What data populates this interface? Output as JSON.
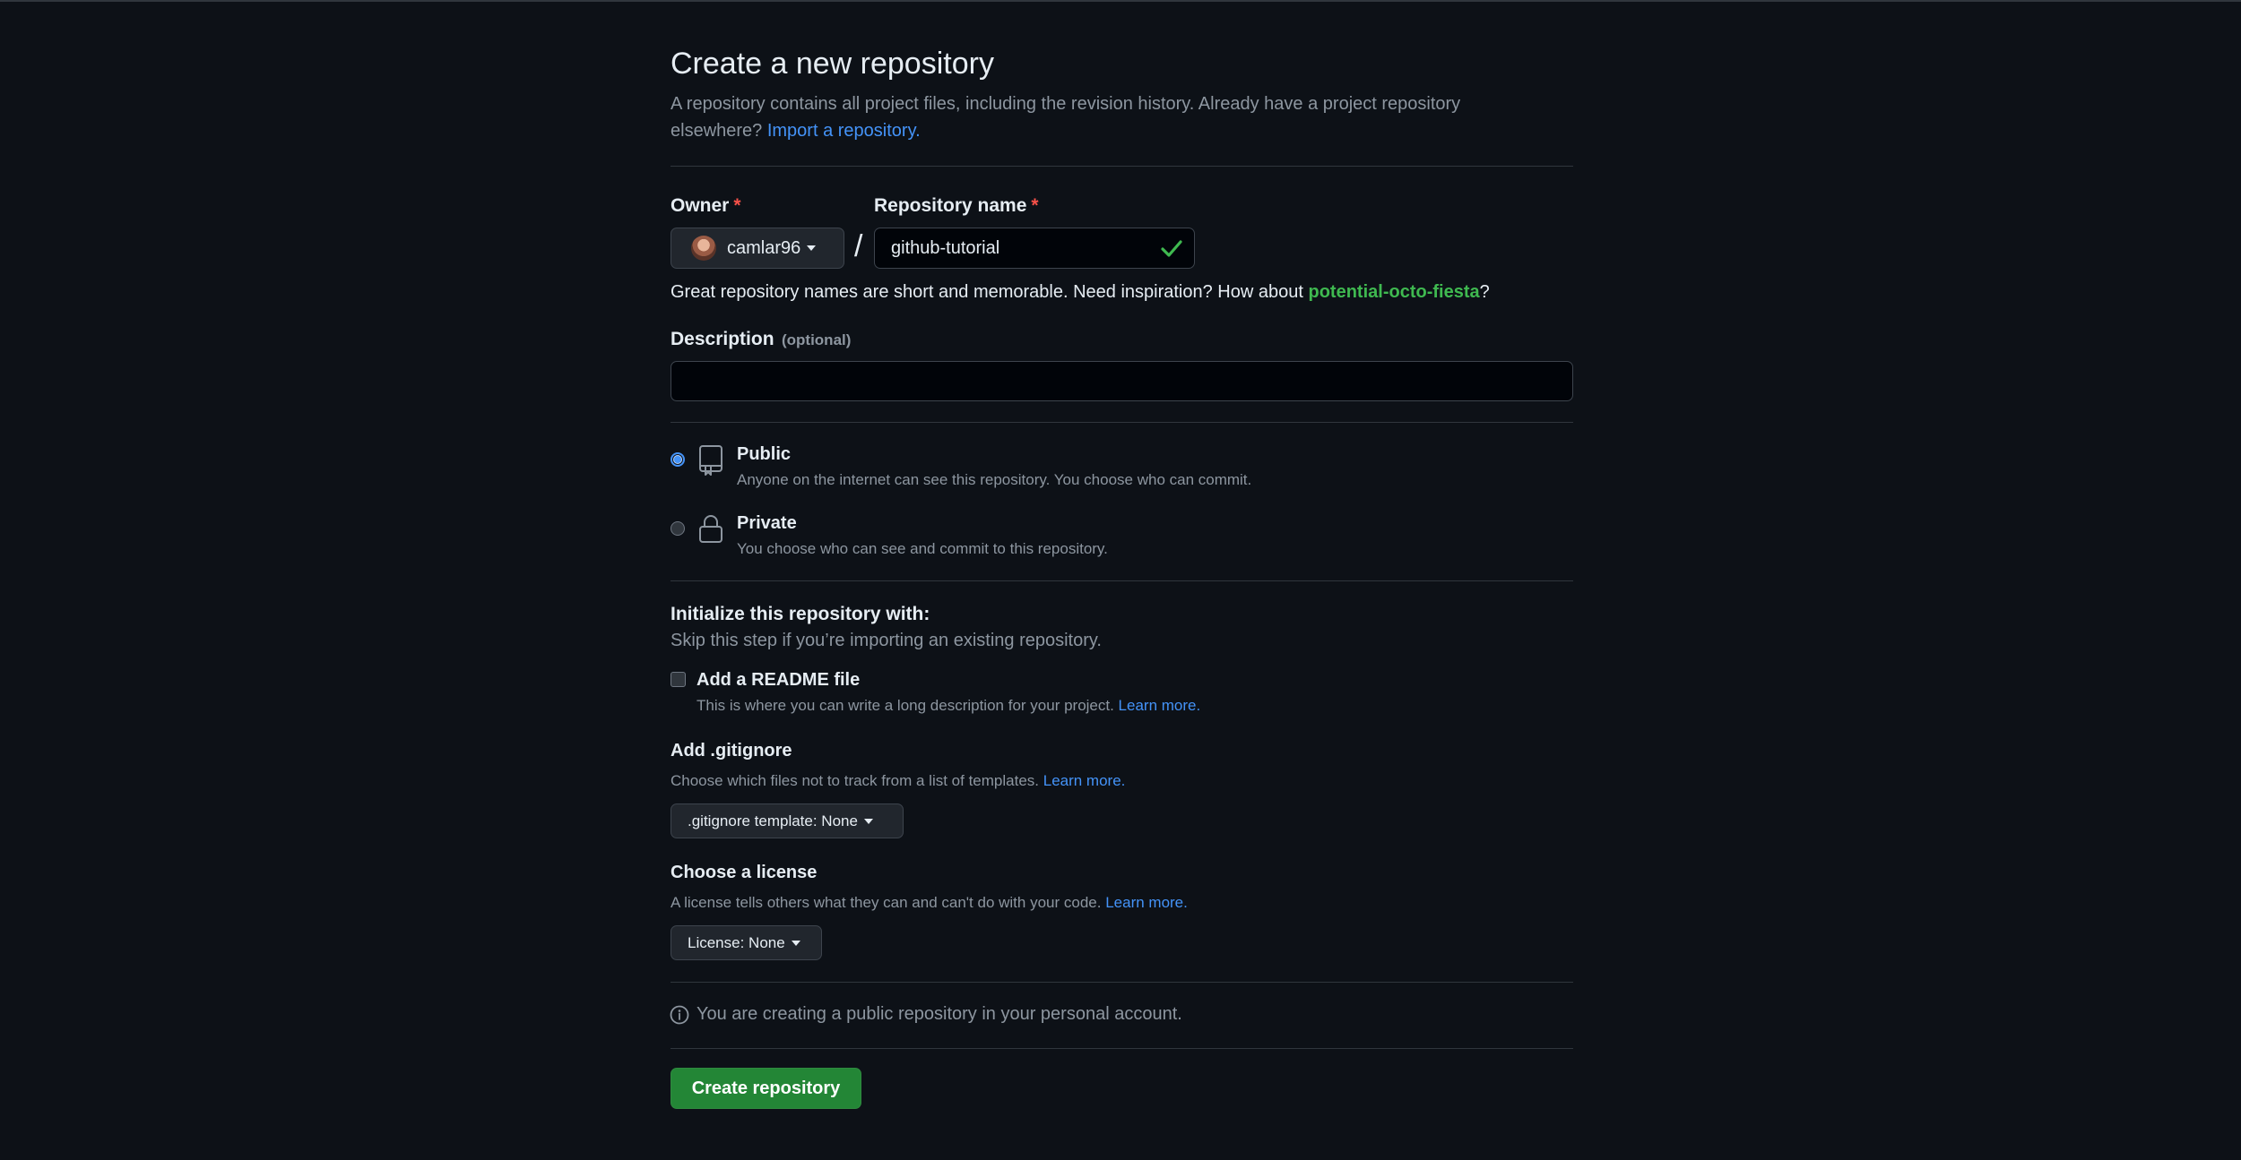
{
  "header": {
    "title": "Create a new repository",
    "intro_line1": "A repository contains all project files, including the revision history. Already have a project repository",
    "intro_line2_prefix": "elsewhere? ",
    "import_link": "Import a repository."
  },
  "owner": {
    "label": "Owner",
    "required_mark": "*",
    "value": "camlar96"
  },
  "slash": "/",
  "repo_name": {
    "label": "Repository name",
    "required_mark": "*",
    "value": "github-tutorial",
    "valid": true
  },
  "name_hint": {
    "prefix": "Great repository names are short and memorable. Need inspiration? How about ",
    "suggestion": "potential-octo-fiesta",
    "suffix": "?"
  },
  "description": {
    "label": "Description",
    "optional": "(optional)",
    "value": "",
    "placeholder": ""
  },
  "visibility": {
    "selected": "public",
    "public": {
      "title": "Public",
      "desc": "Anyone on the internet can see this repository. You choose who can commit.",
      "icon": "repo-icon"
    },
    "private": {
      "title": "Private",
      "desc": "You choose who can see and commit to this repository.",
      "icon": "lock-icon"
    }
  },
  "initialize": {
    "title": "Initialize this repository with:",
    "subtitle": "Skip this step if you’re importing an existing repository."
  },
  "readme": {
    "label": "Add a README file",
    "checked": false,
    "desc": "This is where you can write a long description for your project. ",
    "learn_more": "Learn more."
  },
  "gitignore": {
    "title": "Add .gitignore",
    "desc": "Choose which files not to track from a list of templates. ",
    "learn_more": "Learn more.",
    "button": ".gitignore template: None"
  },
  "license": {
    "title": "Choose a license",
    "desc": "A license tells others what they can and can't do with your code. ",
    "learn_more": "Learn more.",
    "button": "License: None"
  },
  "notice": {
    "icon": "info-icon",
    "text": "You are creating a public repository in your personal account."
  },
  "submit": {
    "label": "Create repository"
  },
  "colors": {
    "background": "#0d1117",
    "accent_link": "#4493f8",
    "success_green": "#3fb950",
    "primary_button": "#238636",
    "required_red": "#f85149"
  }
}
